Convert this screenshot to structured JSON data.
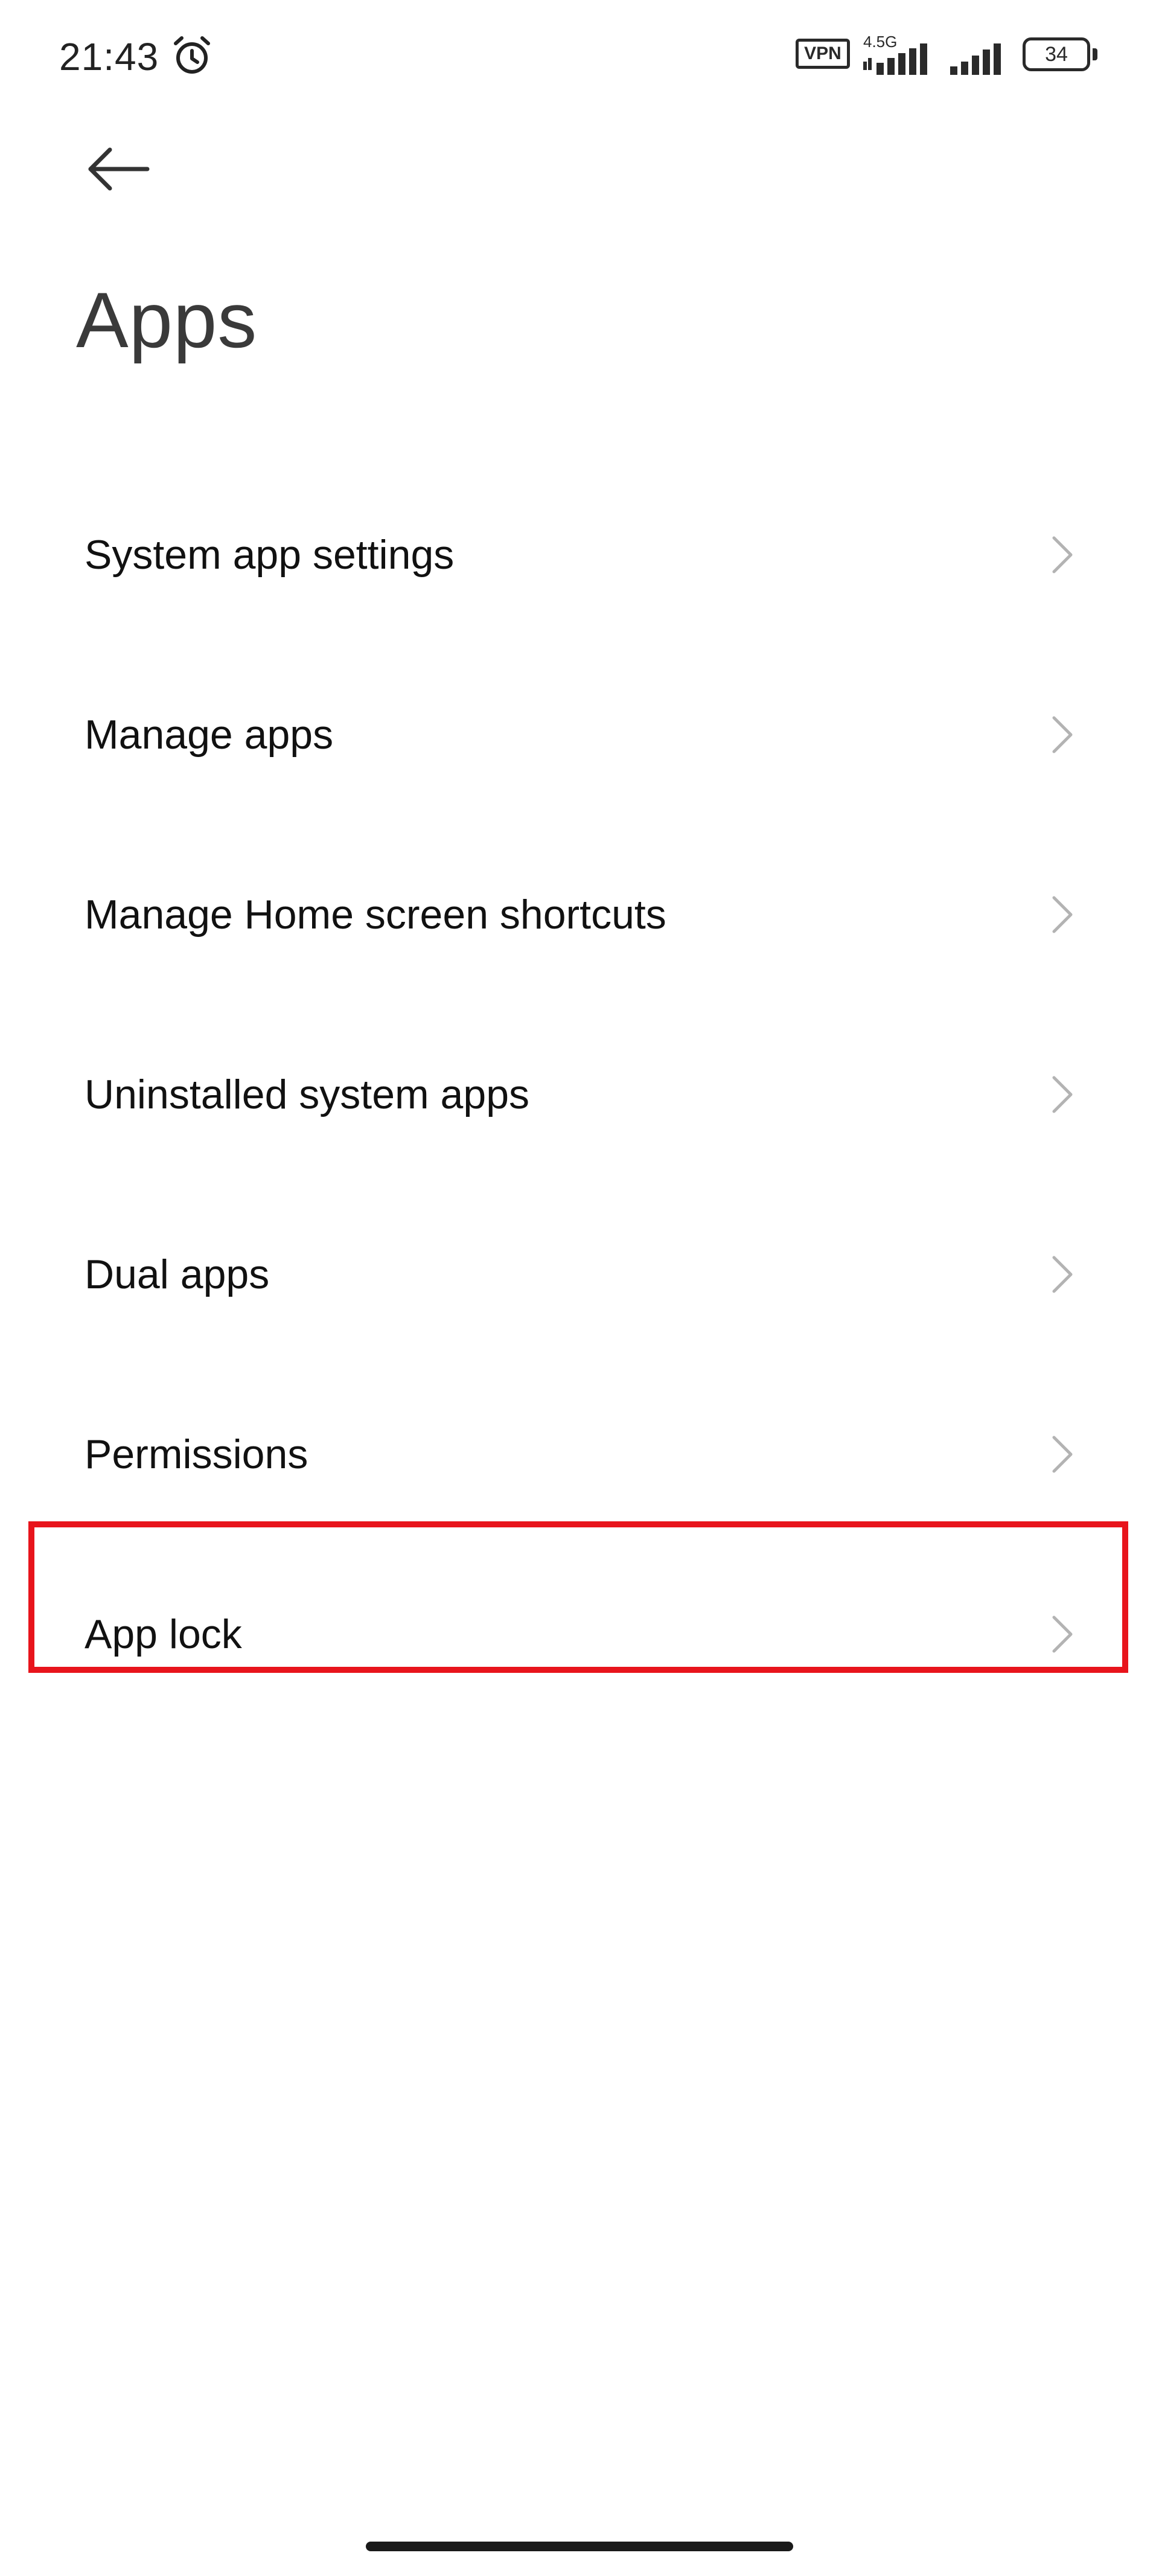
{
  "status_bar": {
    "time": "21:43",
    "alarm_icon": "alarm-clock-icon",
    "vpn_label": "VPN",
    "network_type": "4.5G",
    "battery_level": "34"
  },
  "header": {
    "back_icon": "arrow-left-icon",
    "title": "Apps"
  },
  "settings": {
    "items": [
      {
        "label": "System app settings",
        "icon": "chevron-right-icon"
      },
      {
        "label": "Manage apps",
        "icon": "chevron-right-icon"
      },
      {
        "label": "Manage Home screen shortcuts",
        "icon": "chevron-right-icon"
      },
      {
        "label": "Uninstalled system apps",
        "icon": "chevron-right-icon"
      },
      {
        "label": "Dual apps",
        "icon": "chevron-right-icon"
      },
      {
        "label": "Permissions",
        "icon": "chevron-right-icon"
      },
      {
        "label": "App lock",
        "icon": "chevron-right-icon"
      }
    ],
    "highlighted_item": "App lock",
    "highlight_color": "#e8141c"
  }
}
